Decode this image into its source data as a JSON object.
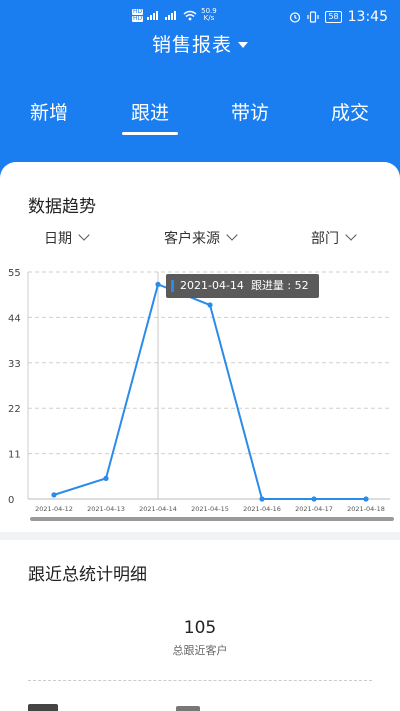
{
  "status_bar": {
    "hd1": "HD",
    "hd2": "HD",
    "net_speed_value": "50.9",
    "net_speed_unit": "K/s",
    "battery": "58",
    "time": "13:45"
  },
  "header": {
    "title": "销售报表"
  },
  "tabs": [
    {
      "label": "新增"
    },
    {
      "label": "跟进"
    },
    {
      "label": "带访"
    },
    {
      "label": "成交"
    }
  ],
  "trend": {
    "title": "数据趋势",
    "filters": [
      {
        "label": "日期"
      },
      {
        "label": "客户来源"
      },
      {
        "label": "部门"
      }
    ]
  },
  "chart_data": {
    "type": "line",
    "categories": [
      "2021-04-12",
      "2021-04-13",
      "2021-04-14",
      "2021-04-15",
      "2021-04-16",
      "2021-04-17",
      "2021-04-18"
    ],
    "series": [
      {
        "name": "跟进量",
        "values": [
          1,
          5,
          52,
          47,
          0,
          0,
          0
        ]
      }
    ],
    "yticks": [
      0,
      11,
      22,
      33,
      44,
      55
    ],
    "ylim": [
      0,
      55
    ],
    "grid": true,
    "color": "#2b8bea",
    "highlight_index": 2,
    "tooltip": {
      "date": "2021-04-14",
      "label": "跟进量 : 52"
    }
  },
  "detail": {
    "title": "跟近总统计明细",
    "total_value": "105",
    "total_label": "总跟近客户"
  }
}
